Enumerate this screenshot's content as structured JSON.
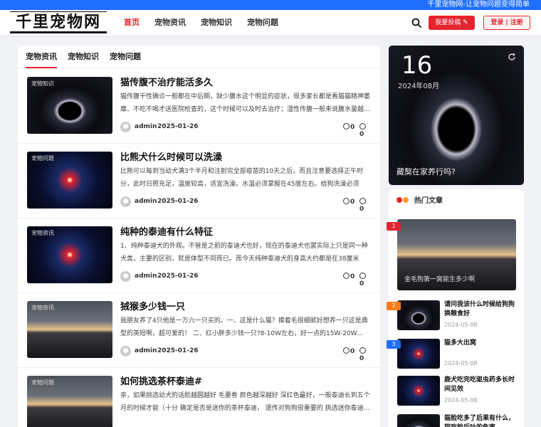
{
  "topbar": {
    "slogan": "千里宠物网-让宠物问题变得简单"
  },
  "header": {
    "logo": "千里宠物网",
    "nav": [
      "首页",
      "宠物资讯",
      "宠物知识",
      "宠物问题"
    ],
    "active_nav": "首页",
    "submit_label": "我要投稿",
    "login_label": "登录",
    "register_label": "注册"
  },
  "tabs": [
    "宠物资讯",
    "宠物知识",
    "宠物问题"
  ],
  "articles": [
    {
      "tag": "宠物知识",
      "title": "猫传腹不治疗能活多久",
      "excerpt": "猫传腹干性确诊一般都在中后期，缺少腹水这个明显的症状，很多家长都是看猫猫精神萎靡、不吃不喝才送医院检查的，这个时候可以及时去治疗；湿性传腹一般来说腹水量越…",
      "author": "admin",
      "date": "2025-01-26",
      "views": "0",
      "comments": "0"
    },
    {
      "tag": "宠物问题",
      "title": "比熊犬什么时候可以洗澡",
      "excerpt": "比熊可以每到当幼犬满3个半月和注射完全部疫苗的10天之后，而且注意要选择正午时分，此时日照充足，温度较高，适宜洗澡。水温必须掌握在45度左右。给狗洗澡必须选…",
      "author": "admin",
      "date": "2025-01-26",
      "views": "0",
      "comments": "0"
    },
    {
      "tag": "宠物资讯",
      "title": "纯种的泰迪有什么特征",
      "excerpt": "1、纯种泰迪犬的外观。不管是之前的泰迪犬也好，现在的泰迪犬也罢实际上只是同一种犬类，主要的区别，就是体型不同而已。而今天纯种泰迪犬的身高大约都是在38厘米左…",
      "author": "admin",
      "date": "2025-01-26",
      "views": "0",
      "comments": "0"
    },
    {
      "tag": "宠物资讯",
      "title": "狨猴多少钱一只",
      "excerpt": "我朋友养了4只他是一万六一只买的。一、这是什么猫？摸着毛很细腻好想养一只这是典型的英短啊，超可爱的！ 二、红小胖多少钱一只?8-10W左右，好一点的15W-20W…",
      "author": "admin",
      "date": "2025-01-26",
      "views": "0",
      "comments": "0"
    },
    {
      "tag": "宠物问题",
      "title": "如何挑选茶杯泰迪#",
      "excerpt": "亲，如果挑选幼犬的话脸越圆越好 毛要卷 颜色越深越好 深红色最好，一般泰迪长到五个月的时候才能（十分 确定是否是迷你的茶杯泰迪， 遗传对狗狗很重要的 挑选迷你泰迪…",
      "author": "admin",
      "date": "2025-01-26",
      "views": "0",
      "comments": "0"
    }
  ],
  "feature": {
    "day": "16",
    "month": "2024年08月",
    "title": "藏獒在家养行吗?"
  },
  "hot": {
    "heading": "热门文章",
    "dot_colors": [
      "#e4242f",
      "#ff9a2e"
    ],
    "big": {
      "rank": "1",
      "title": "金毛狗第一窝能生多少啊"
    },
    "items": [
      {
        "rank": "2",
        "title": "请问我该什么时候给狗狗换粮食好",
        "date": "2024-05-08"
      },
      {
        "rank": "3",
        "title": "猫多大出窝",
        "date": "2024-05-08"
      },
      {
        "rank": "",
        "title": "鹿犬吃完吃驱虫药多长时间见效",
        "date": "2024-05-08"
      },
      {
        "rank": "",
        "title": "猫脸吃多了后果有什么，猫吃脸后吐的危害",
        "date": ""
      }
    ],
    "rank_colors": [
      "#e4242f",
      "#ff7a1a",
      "#1e6fff"
    ]
  }
}
